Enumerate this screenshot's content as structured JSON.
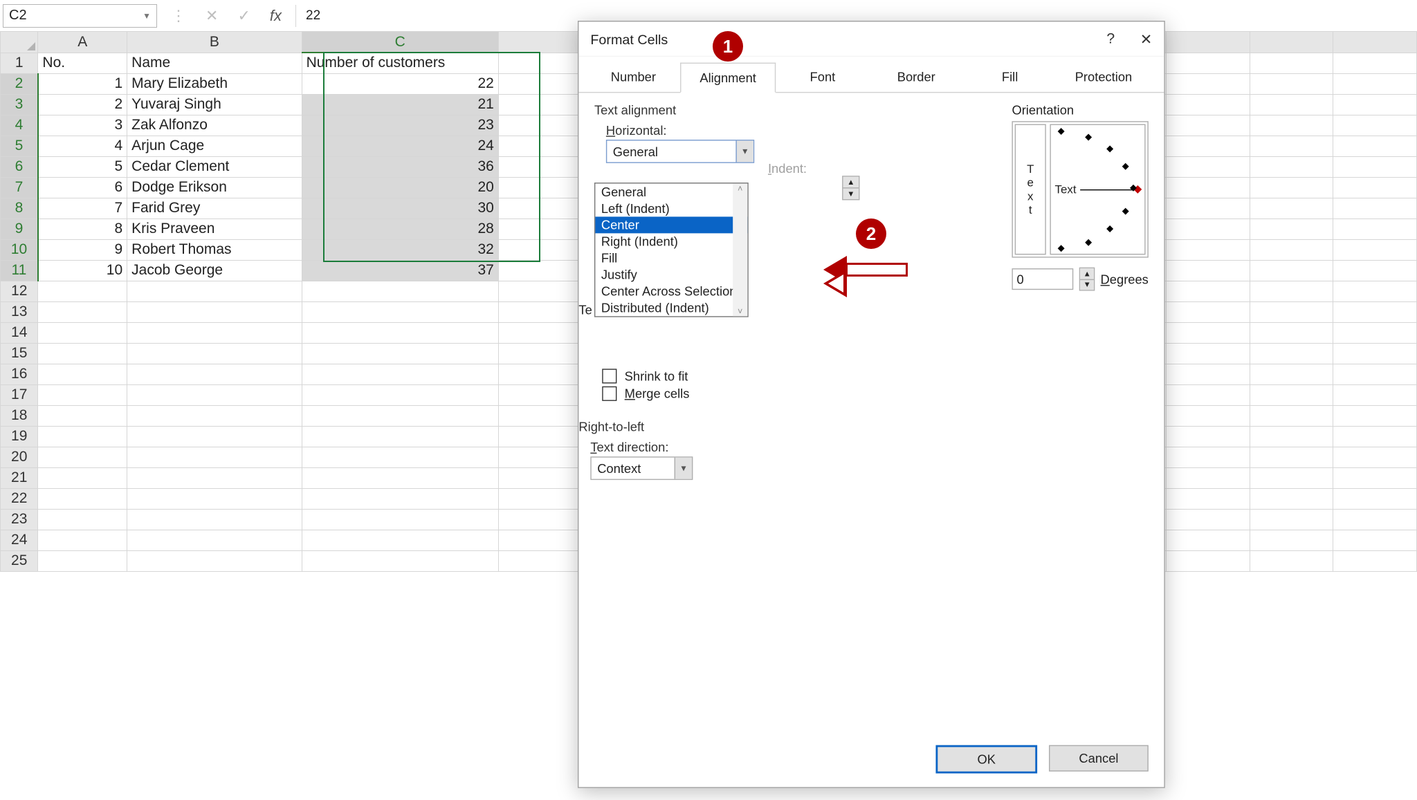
{
  "name_box": "C2",
  "formula_value": "22",
  "columns": [
    "A",
    "B",
    "C"
  ],
  "headers": {
    "A": "No.",
    "B": "Name",
    "C": "Number of customers"
  },
  "rows": [
    {
      "n": 1,
      "name": "Mary Elizabeth",
      "c": 22
    },
    {
      "n": 2,
      "name": "Yuvaraj Singh",
      "c": 21
    },
    {
      "n": 3,
      "name": "Zak Alfonzo",
      "c": 23
    },
    {
      "n": 4,
      "name": "Arjun Cage",
      "c": 24
    },
    {
      "n": 5,
      "name": "Cedar Clement",
      "c": 36
    },
    {
      "n": 6,
      "name": "Dodge Erikson",
      "c": 20
    },
    {
      "n": 7,
      "name": "Farid Grey",
      "c": 30
    },
    {
      "n": 8,
      "name": "Kris Praveen",
      "c": 28
    },
    {
      "n": 9,
      "name": "Robert Thomas",
      "c": 32
    },
    {
      "n": 10,
      "name": "Jacob George",
      "c": 37
    }
  ],
  "row_numbers": [
    1,
    2,
    3,
    4,
    5,
    6,
    7,
    8,
    9,
    10,
    11,
    12,
    13,
    14,
    15,
    16,
    17,
    18,
    19,
    20,
    21,
    22,
    23,
    24,
    25
  ],
  "dialog": {
    "title": "Format Cells",
    "tabs": [
      "Number",
      "Alignment",
      "Font",
      "Border",
      "Fill",
      "Protection"
    ],
    "active_tab": "Alignment",
    "text_alignment_label": "Text alignment",
    "horizontal_label": "Horizontal:",
    "horizontal_value": "General",
    "horizontal_options": [
      "General",
      "Left (Indent)",
      "Center",
      "Right (Indent)",
      "Fill",
      "Justify",
      "Center Across Selection",
      "Distributed (Indent)"
    ],
    "horizontal_selected": "Center",
    "indent_label": "Indent:",
    "vertical_truncated": "Te",
    "shrink_label": "Shrink to fit",
    "merge_label": "Merge cells",
    "rtl_label": "Right-to-left",
    "text_dir_label": "Text direction:",
    "text_dir_value": "Context",
    "orientation_label": "Orientation",
    "orient_vtext": [
      "T",
      "e",
      "x",
      "t"
    ],
    "orient_htext": "Text",
    "degrees_value": "0",
    "degrees_label": "Degrees",
    "ok": "OK",
    "cancel": "Cancel"
  },
  "callouts": {
    "b1": "1",
    "b2": "2"
  }
}
